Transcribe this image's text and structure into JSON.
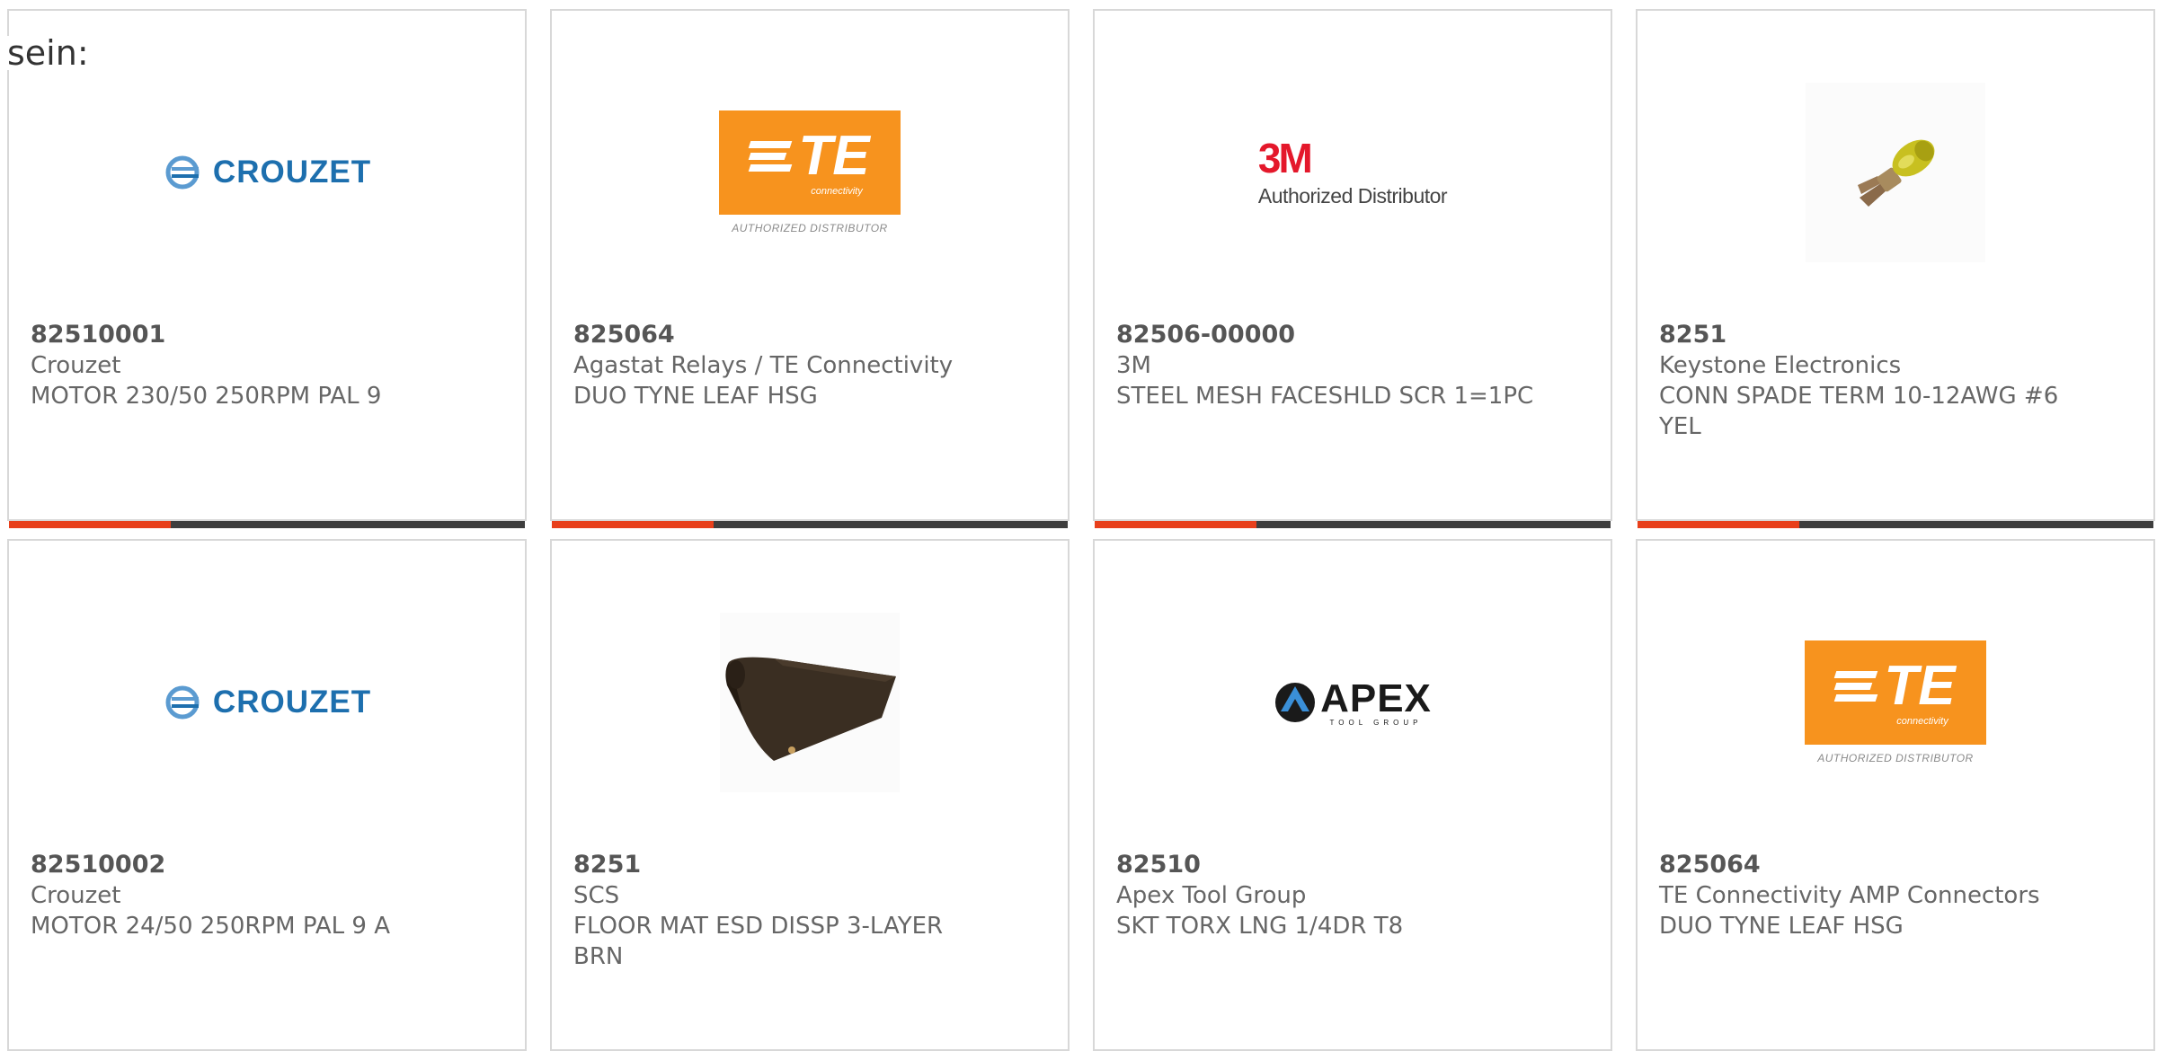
{
  "intro_text": "sein:",
  "colors": {
    "accent_bar": "#e8401c",
    "bar_track": "#3e3e3e",
    "crouzet_blue": "#1d6fae",
    "crouzet_light": "#5b9bd1",
    "te_orange": "#f7931e",
    "mmm_red": "#e4182b"
  },
  "cards": [
    {
      "part_number": "82510001",
      "manufacturer": "Crouzet",
      "description": "MOTOR 230/50 250RPM PAL 9",
      "logo": {
        "type": "crouzet",
        "text": "CROUZET"
      }
    },
    {
      "part_number": "825064",
      "manufacturer": "Agastat Relays / TE Connectivity",
      "description": "DUO TYNE LEAF HSG",
      "logo": {
        "type": "te",
        "text": "TE",
        "sub": "connectivity",
        "caption": "AUTHORIZED DISTRIBUTOR"
      }
    },
    {
      "part_number": "82506-00000",
      "manufacturer": "3M",
      "description": "STEEL MESH FACESHLD SCR 1=1PC",
      "logo": {
        "type": "3m",
        "text": "3M",
        "caption": "Authorized Distributor"
      }
    },
    {
      "part_number": "8251",
      "manufacturer": "Keystone Electronics",
      "description": "CONN SPADE TERM 10-12AWG #6 YEL",
      "logo": {
        "type": "spade-photo"
      }
    },
    {
      "part_number": "82510002",
      "manufacturer": "Crouzet",
      "description": "MOTOR 24/50 250RPM PAL 9 A",
      "logo": {
        "type": "crouzet",
        "text": "CROUZET"
      }
    },
    {
      "part_number": "8251",
      "manufacturer": "SCS",
      "description": "FLOOR MAT ESD DISSP 3-LAYER BRN",
      "logo": {
        "type": "mat-photo"
      }
    },
    {
      "part_number": "82510",
      "manufacturer": "Apex Tool Group",
      "description": "SKT TORX LNG 1/4DR T8",
      "logo": {
        "type": "apex",
        "text": "APEX",
        "sub": "TOOL GROUP"
      }
    },
    {
      "part_number": "825064",
      "manufacturer": "TE Connectivity AMP Connectors",
      "description": "DUO TYNE LEAF HSG",
      "logo": {
        "type": "te",
        "text": "TE",
        "sub": "connectivity",
        "caption": "AUTHORIZED DISTRIBUTOR"
      }
    }
  ]
}
